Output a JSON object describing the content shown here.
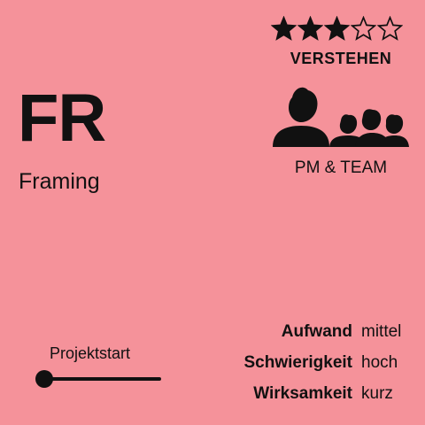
{
  "card": {
    "abbreviation": "FR",
    "name": "Framing",
    "background_color": "#f5929a"
  },
  "rating": {
    "filled_stars": 3,
    "total_stars": 5,
    "label": "VERSTEHEN",
    "star_icon": "star-icon"
  },
  "audience": {
    "icon": "team-icon",
    "label": "PM & TEAM"
  },
  "timeline": {
    "label": "Projektstart",
    "position": 0
  },
  "metrics": [
    {
      "key": "Aufwand",
      "value": "mittel"
    },
    {
      "key": "Schwierigkeit",
      "value": "hoch"
    },
    {
      "key": "Wirksamkeit",
      "value": "kurz"
    }
  ]
}
